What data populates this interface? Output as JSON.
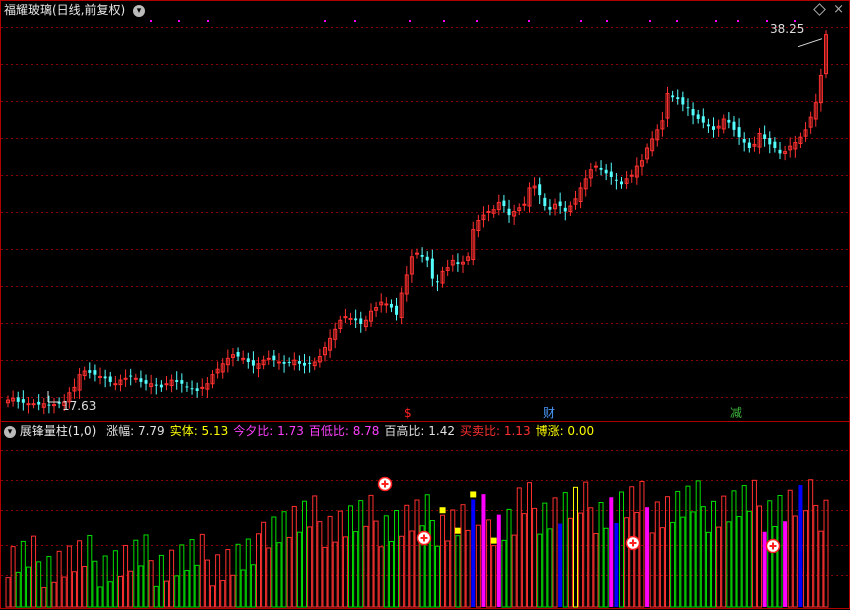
{
  "main_panel": {
    "title": "福耀玻璃(日线,前复权)",
    "high_label": "38.25",
    "low_label": "17.63",
    "events": [
      "$",
      "财",
      "减"
    ],
    "event_colors": [
      "#ff2020",
      "#4a9bff",
      "#3cb83c"
    ]
  },
  "sub_panel": {
    "title": "展锋量柱(1,0)",
    "stats": [
      {
        "label": "涨幅:",
        "value": "7.79",
        "color": "#e0e0e0"
      },
      {
        "label": "实体:",
        "value": "5.13",
        "color": "#ffff00"
      },
      {
        "label": "今夕比:",
        "value": "1.73",
        "color": "#ff40ff"
      },
      {
        "label": "百低比:",
        "value": "8.78",
        "color": "#ff40ff"
      },
      {
        "label": "百高比:",
        "value": "1.42",
        "color": "#e0e0e0"
      },
      {
        "label": "买卖比:",
        "value": "1.13",
        "color": "#ff3030"
      },
      {
        "label": "博涨:",
        "value": "0.00",
        "color": "#ffff00"
      }
    ]
  },
  "colors": {
    "up": "#ff3030",
    "down": "#54ffff",
    "grid": "#8b0000",
    "border": "#b00000",
    "magenta": "#ff00ff",
    "blue": "#0000ff",
    "green": "#00e000",
    "yellow": "#ffff00"
  },
  "chart_data": {
    "type": "candlestick",
    "x": [
      1,
      2,
      3,
      4,
      5,
      6,
      7,
      8,
      9,
      10,
      11,
      12,
      13,
      14,
      15,
      16,
      17,
      18,
      19,
      20,
      21,
      22,
      23,
      24,
      25,
      26,
      27,
      28,
      29,
      30,
      31,
      32,
      33,
      34,
      35,
      36,
      37,
      38,
      39,
      40,
      41,
      42,
      43,
      44,
      45,
      46,
      47,
      48,
      49,
      50,
      51,
      52,
      53,
      54,
      55,
      56,
      57,
      58,
      59,
      60,
      61,
      62,
      63,
      64,
      65,
      66,
      67,
      68,
      69,
      70,
      71,
      72,
      73,
      74,
      75,
      76,
      77,
      78,
      79,
      80,
      81,
      82,
      83,
      84,
      85,
      86,
      87,
      88,
      89,
      90,
      91,
      92,
      93,
      94,
      95,
      96,
      97,
      98,
      99,
      100,
      101,
      102,
      103,
      104,
      105,
      106,
      107,
      108,
      109,
      110,
      111,
      112,
      113,
      114,
      115,
      116,
      117,
      118,
      119,
      120,
      121,
      122,
      123,
      124,
      125,
      126,
      127,
      128,
      129,
      130,
      131,
      132,
      133,
      134,
      135,
      136,
      137,
      138,
      139,
      140,
      141,
      142,
      143,
      144,
      145,
      146,
      147,
      148,
      149,
      150,
      151,
      152,
      153,
      154,
      155,
      156,
      157,
      158,
      159,
      160,
      161,
      162,
      163,
      164,
      165,
      166,
      167,
      168,
      169,
      170,
      171,
      172,
      173,
      174,
      175,
      176,
      177,
      178,
      179,
      180,
      181,
      182,
      183,
      184,
      185,
      186,
      187,
      188,
      189,
      190,
      191,
      192,
      193,
      194,
      195,
      196,
      197,
      198,
      199,
      200,
      201,
      202,
      203
    ],
    "close": [
      18.1,
      18.2,
      18.0,
      17.95,
      17.9,
      17.9,
      17.85,
      17.9,
      17.8,
      17.85,
      17.9,
      18.0,
      18.5,
      18.8,
      19.5,
      19.7,
      19.6,
      19.5,
      19.4,
      19.3,
      19.1,
      19.0,
      19.2,
      19.3,
      19.4,
      19.3,
      19.1,
      19.0,
      19.0,
      18.9,
      18.8,
      19.0,
      19.2,
      19.1,
      19.0,
      18.8,
      18.7,
      18.6,
      18.8,
      19.0,
      19.5,
      19.8,
      20.1,
      20.4,
      20.6,
      20.5,
      20.4,
      20.2,
      20.0,
      20.1,
      20.3,
      20.4,
      20.3,
      20.2,
      20.1,
      20.2,
      20.3,
      20.1,
      20.0,
      20.1,
      20.2,
      20.5,
      21.0,
      21.5,
      22.0,
      22.5,
      22.7,
      22.6,
      22.5,
      22.3,
      22.5,
      23.0,
      23.2,
      23.5,
      23.4,
      23.2,
      22.8,
      24.0,
      25.0,
      26.0,
      26.2,
      26.0,
      25.8,
      24.8,
      24.6,
      25.2,
      25.4,
      25.8,
      25.6,
      25.7,
      26.0,
      27.5,
      28.0,
      28.3,
      28.5,
      28.6,
      29.0,
      28.8,
      28.3,
      28.5,
      28.7,
      28.9,
      29.8,
      29.9,
      29.4,
      28.8,
      28.6,
      28.9,
      28.8,
      28.5,
      28.8,
      29.2,
      29.8,
      30.3,
      30.8,
      31.0,
      30.8,
      30.6,
      30.4,
      30.2,
      30.0,
      30.3,
      30.5,
      31.0,
      31.3,
      32.0,
      32.5,
      33.0,
      33.5,
      35.0,
      34.8,
      34.7,
      34.4,
      34.2,
      33.8,
      33.6,
      33.4,
      33.2,
      33.0,
      33.2,
      33.6,
      33.4,
      33.0,
      32.6,
      32.3,
      32.0,
      32.2,
      32.8,
      32.5,
      32.2,
      32.0,
      31.7,
      31.8,
      32.1,
      32.3,
      32.6,
      33.0,
      33.7,
      34.5,
      36.0,
      38.25
    ],
    "high_price": 38.25,
    "low_price": 17.63,
    "event_marks": [
      "$",
      "财",
      "减"
    ],
    "volume_ylim": [
      0,
      100
    ]
  }
}
